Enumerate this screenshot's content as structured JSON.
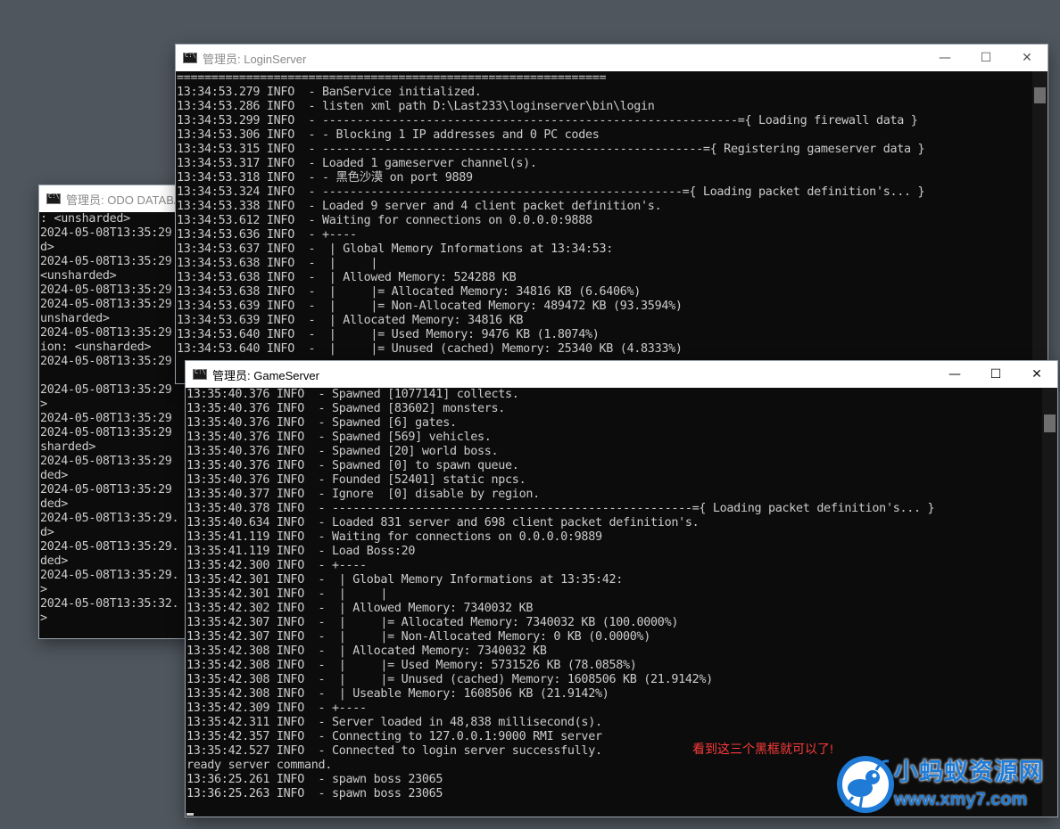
{
  "odo_window": {
    "title": "管理员:  ODO DATABA",
    "lines": [
      ": <unsharded>",
      "2024-05-08T13:35:29",
      "d>",
      "2024-05-08T13:35:29",
      "<unsharded>",
      "2024-05-08T13:35:29",
      "2024-05-08T13:35:29",
      "unsharded>",
      "2024-05-08T13:35:29",
      "ion: <unsharded>",
      "2024-05-08T13:35:29",
      "",
      "2024-05-08T13:35:29",
      ">",
      "2024-05-08T13:35:29",
      "2024-05-08T13:35:29",
      "sharded>",
      "2024-05-08T13:35:29",
      "ded>",
      "2024-05-08T13:35:29",
      "ded>",
      "2024-05-08T13:35:29.",
      "d>",
      "2024-05-08T13:35:29.",
      "ded>",
      "2024-05-08T13:35:29.",
      ">",
      "2024-05-08T13:35:32.",
      ">"
    ]
  },
  "login_window": {
    "title": "管理员:  LoginServer",
    "minimize": "—",
    "maximize": "☐",
    "close": "✕",
    "lines": [
      "==============================================================",
      "13:34:53.279 INFO  - BanService initialized.",
      "13:34:53.286 INFO  - listen xml path D:\\Last233\\loginserver\\bin\\login",
      "13:34:53.299 INFO  - ------------------------------------------------------------={ Loading firewall data }",
      "13:34:53.306 INFO  - - Blocking 1 IP addresses and 0 PC codes",
      "13:34:53.315 INFO  - -------------------------------------------------------={ Registering gameserver data }",
      "13:34:53.317 INFO  - Loaded 1 gameserver channel(s).",
      "13:34:53.318 INFO  - - 黑色沙漠 on port 9889",
      "13:34:53.324 INFO  - ----------------------------------------------------={ Loading packet definition's... }",
      "13:34:53.338 INFO  - Loaded 9 server and 4 client packet definition's.",
      "13:34:53.612 INFO  - Waiting for connections on 0.0.0.0:9888",
      "13:34:53.636 INFO  - +----",
      "13:34:53.637 INFO  -  | Global Memory Informations at 13:34:53:",
      "13:34:53.638 INFO  -  |     |",
      "13:34:53.638 INFO  -  | Allowed Memory: 524288 KB",
      "13:34:53.638 INFO  -  |     |= Allocated Memory: 34816 KB (6.6406%)",
      "13:34:53.639 INFO  -  |     |= Non-Allocated Memory: 489472 KB (93.3594%)",
      "13:34:53.639 INFO  -  | Allocated Memory: 34816 KB",
      "13:34:53.640 INFO  -  |     |= Used Memory: 9476 KB (1.8074%)",
      "13:34:53.640 INFO  -  |     |= Unused (cached) Memory: 25340 KB (4.8333%)"
    ]
  },
  "game_window": {
    "title": "管理员:  GameServer",
    "minimize": "—",
    "maximize": "☐",
    "close": "✕",
    "lines": [
      "13:35:40.376 INFO  - Spawned [1077141] collects.",
      "13:35:40.376 INFO  - Spawned [83602] monsters.",
      "13:35:40.376 INFO  - Spawned [6] gates.",
      "13:35:40.376 INFO  - Spawned [569] vehicles.",
      "13:35:40.376 INFO  - Spawned [20] world boss.",
      "13:35:40.376 INFO  - Spawned [0] to spawn queue.",
      "13:35:40.376 INFO  - Founded [52401] static npcs.",
      "13:35:40.377 INFO  - Ignore  [0] disable by region.",
      "13:35:40.378 INFO  - ----------------------------------------------------={ Loading packet definition's... }",
      "13:35:40.634 INFO  - Loaded 831 server and 698 client packet definition's.",
      "13:35:41.119 INFO  - Waiting for connections on 0.0.0.0:9889",
      "13:35:41.119 INFO  - Load Boss:20",
      "13:35:42.300 INFO  - +----",
      "13:35:42.301 INFO  -  | Global Memory Informations at 13:35:42:",
      "13:35:42.301 INFO  -  |     |",
      "13:35:42.302 INFO  -  | Allowed Memory: 7340032 KB",
      "13:35:42.307 INFO  -  |     |= Allocated Memory: 7340032 KB (100.0000%)",
      "13:35:42.307 INFO  -  |     |= Non-Allocated Memory: 0 KB (0.0000%)",
      "13:35:42.308 INFO  -  | Allocated Memory: 7340032 KB",
      "13:35:42.308 INFO  -  |     |= Used Memory: 5731526 KB (78.0858%)",
      "13:35:42.308 INFO  -  |     |= Unused (cached) Memory: 1608506 KB (21.9142%)",
      "13:35:42.308 INFO  -  | Useable Memory: 1608506 KB (21.9142%)",
      "13:35:42.309 INFO  - +----",
      "13:35:42.311 INFO  - Server loaded in 48,838 millisecond(s).",
      "13:35:42.357 INFO  - Connecting to 127.0.0.1:9000 RMI server",
      "13:35:42.527 INFO  - Connected to login server successfully.",
      "ready server command.",
      "13:36:25.261 INFO  - spawn boss 23065",
      "13:36:25.263 INFO  - spawn boss 23065"
    ]
  },
  "annotation": "看到这三个黑框就可以了!",
  "watermark": {
    "title": "小蚂蚁资源网",
    "url": "www.xmy7.com"
  },
  "colors": {
    "desktop": "#4f565e",
    "console_bg": "#0c0c0c",
    "console_text": "#cccccc",
    "annotation": "#ff3b3b",
    "watermark": "#1f7bd6"
  }
}
